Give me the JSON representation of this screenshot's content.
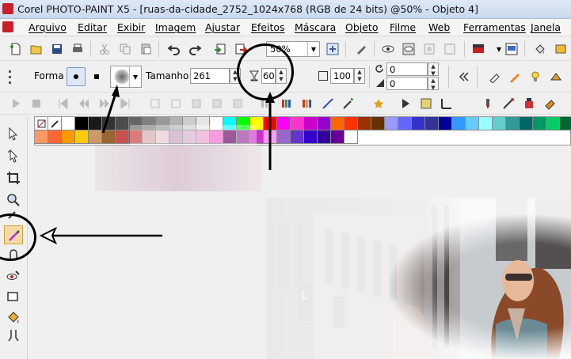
{
  "window": {
    "title": "Corel PHOTO-PAINT X5 - [ruas-da-cidade_2752_1024x768 (RGB de 24 bits) @50% - Objeto 4]"
  },
  "menu": [
    {
      "label": "Arquivo",
      "name": "menu-arquivo"
    },
    {
      "label": "Editar",
      "name": "menu-editar"
    },
    {
      "label": "Exibir",
      "name": "menu-exibir"
    },
    {
      "label": "Imagem",
      "name": "menu-imagem"
    },
    {
      "label": "Ajustar",
      "name": "menu-ajustar"
    },
    {
      "label": "Efeitos",
      "name": "menu-efeitos"
    },
    {
      "label": "Máscara",
      "name": "menu-mascara"
    },
    {
      "label": "Objeto",
      "name": "menu-objeto"
    },
    {
      "label": "Filme",
      "name": "menu-filme"
    },
    {
      "label": "Web",
      "name": "menu-web"
    },
    {
      "label": "Ferramentas",
      "name": "menu-ferramentas"
    },
    {
      "label": "Janela",
      "name": "menu-janela"
    }
  ],
  "standard_toolbar": {
    "zoom_value": "50%"
  },
  "property_bar": {
    "shape_label": "Forma",
    "size_label": "Tamanho",
    "size_value": "261",
    "transparency_value": "60",
    "opacity_value": "100",
    "rotate_value": "0",
    "flatten_value": "0"
  },
  "colors": {
    "accent": "#c8202a",
    "annotation": "#000000"
  },
  "palette_row1": [
    "#ffffff",
    "#000000",
    "#1a1a1a",
    "#333333",
    "#4d4d4d",
    "#666666",
    "#808080",
    "#999999",
    "#b3b3b3",
    "#cccccc",
    "#e6e6e6",
    "#ffffff",
    "#00ffff",
    "#00ff00",
    "#ffff00",
    "#ff0000",
    "#ff00ff",
    "#ff33cc",
    "#cc00cc",
    "#9900cc",
    "#ff6600",
    "#ff3300",
    "#993300",
    "#663300",
    "#9999ff",
    "#6666ff",
    "#3333cc",
    "#333399",
    "#000099",
    "#3399ff",
    "#66ccff",
    "#99ffff",
    "#66cccc",
    "#339999",
    "#006666",
    "#009966",
    "#00cc66",
    "#006633"
  ],
  "palette_row2": [
    "#ff9966",
    "#ff6633",
    "#ff9900",
    "#ffcc00",
    "#cc9966",
    "#996633",
    "#c85050",
    "#cc3333",
    "#d4a9a9",
    "#e8c8d0",
    "#c8a0c0",
    "#d8b0d0",
    "#e8a0d0",
    "#ff66cc",
    "#660066",
    "#993399",
    "#cc33cc",
    "#ff99ff",
    "#9966cc",
    "#6633cc",
    "#3300cc",
    "#330099",
    "#660099",
    "#ffffff"
  ]
}
